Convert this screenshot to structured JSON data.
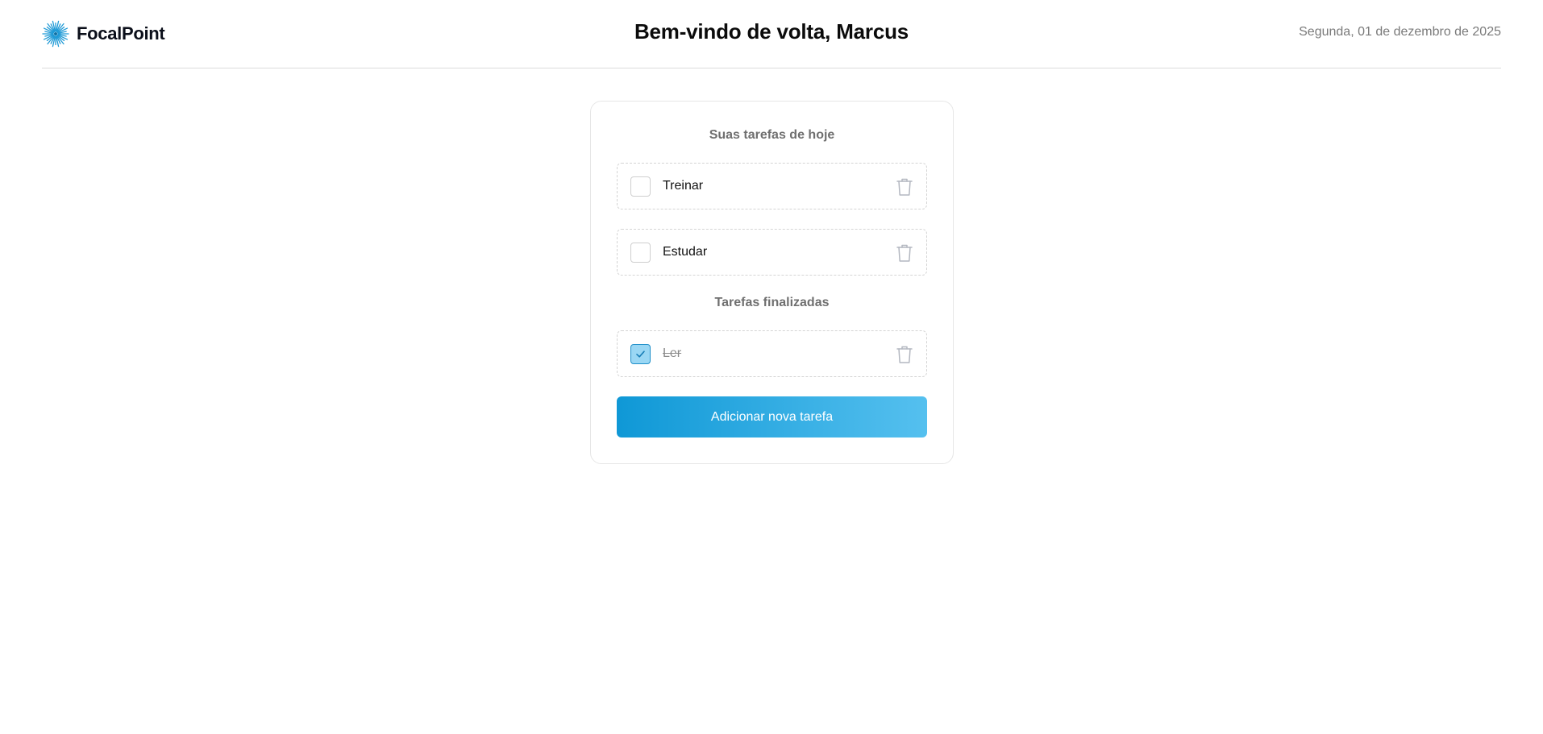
{
  "header": {
    "brand_name": "FocalPoint",
    "logo_icon": "sunburst-logo-icon",
    "welcome": "Bem-vindo de volta, Marcus",
    "date": "Segunda, 01 de dezembro de 2025"
  },
  "today": {
    "title": "Suas tarefas de hoje",
    "tasks": [
      {
        "label": "Treinar",
        "checked": false
      },
      {
        "label": "Estudar",
        "checked": false
      }
    ]
  },
  "finished": {
    "title": "Tarefas finalizadas",
    "tasks": [
      {
        "label": "Ler",
        "checked": true
      }
    ]
  },
  "actions": {
    "add_label": "Adicionar nova tarefa"
  },
  "icons": {
    "delete": "trash-icon",
    "check": "check-icon"
  },
  "colors": {
    "accent": "#0f98d6",
    "accent_light": "#55c0ef",
    "checked_fill": "#9ad7f4",
    "muted_text": "#7a7a7a"
  }
}
